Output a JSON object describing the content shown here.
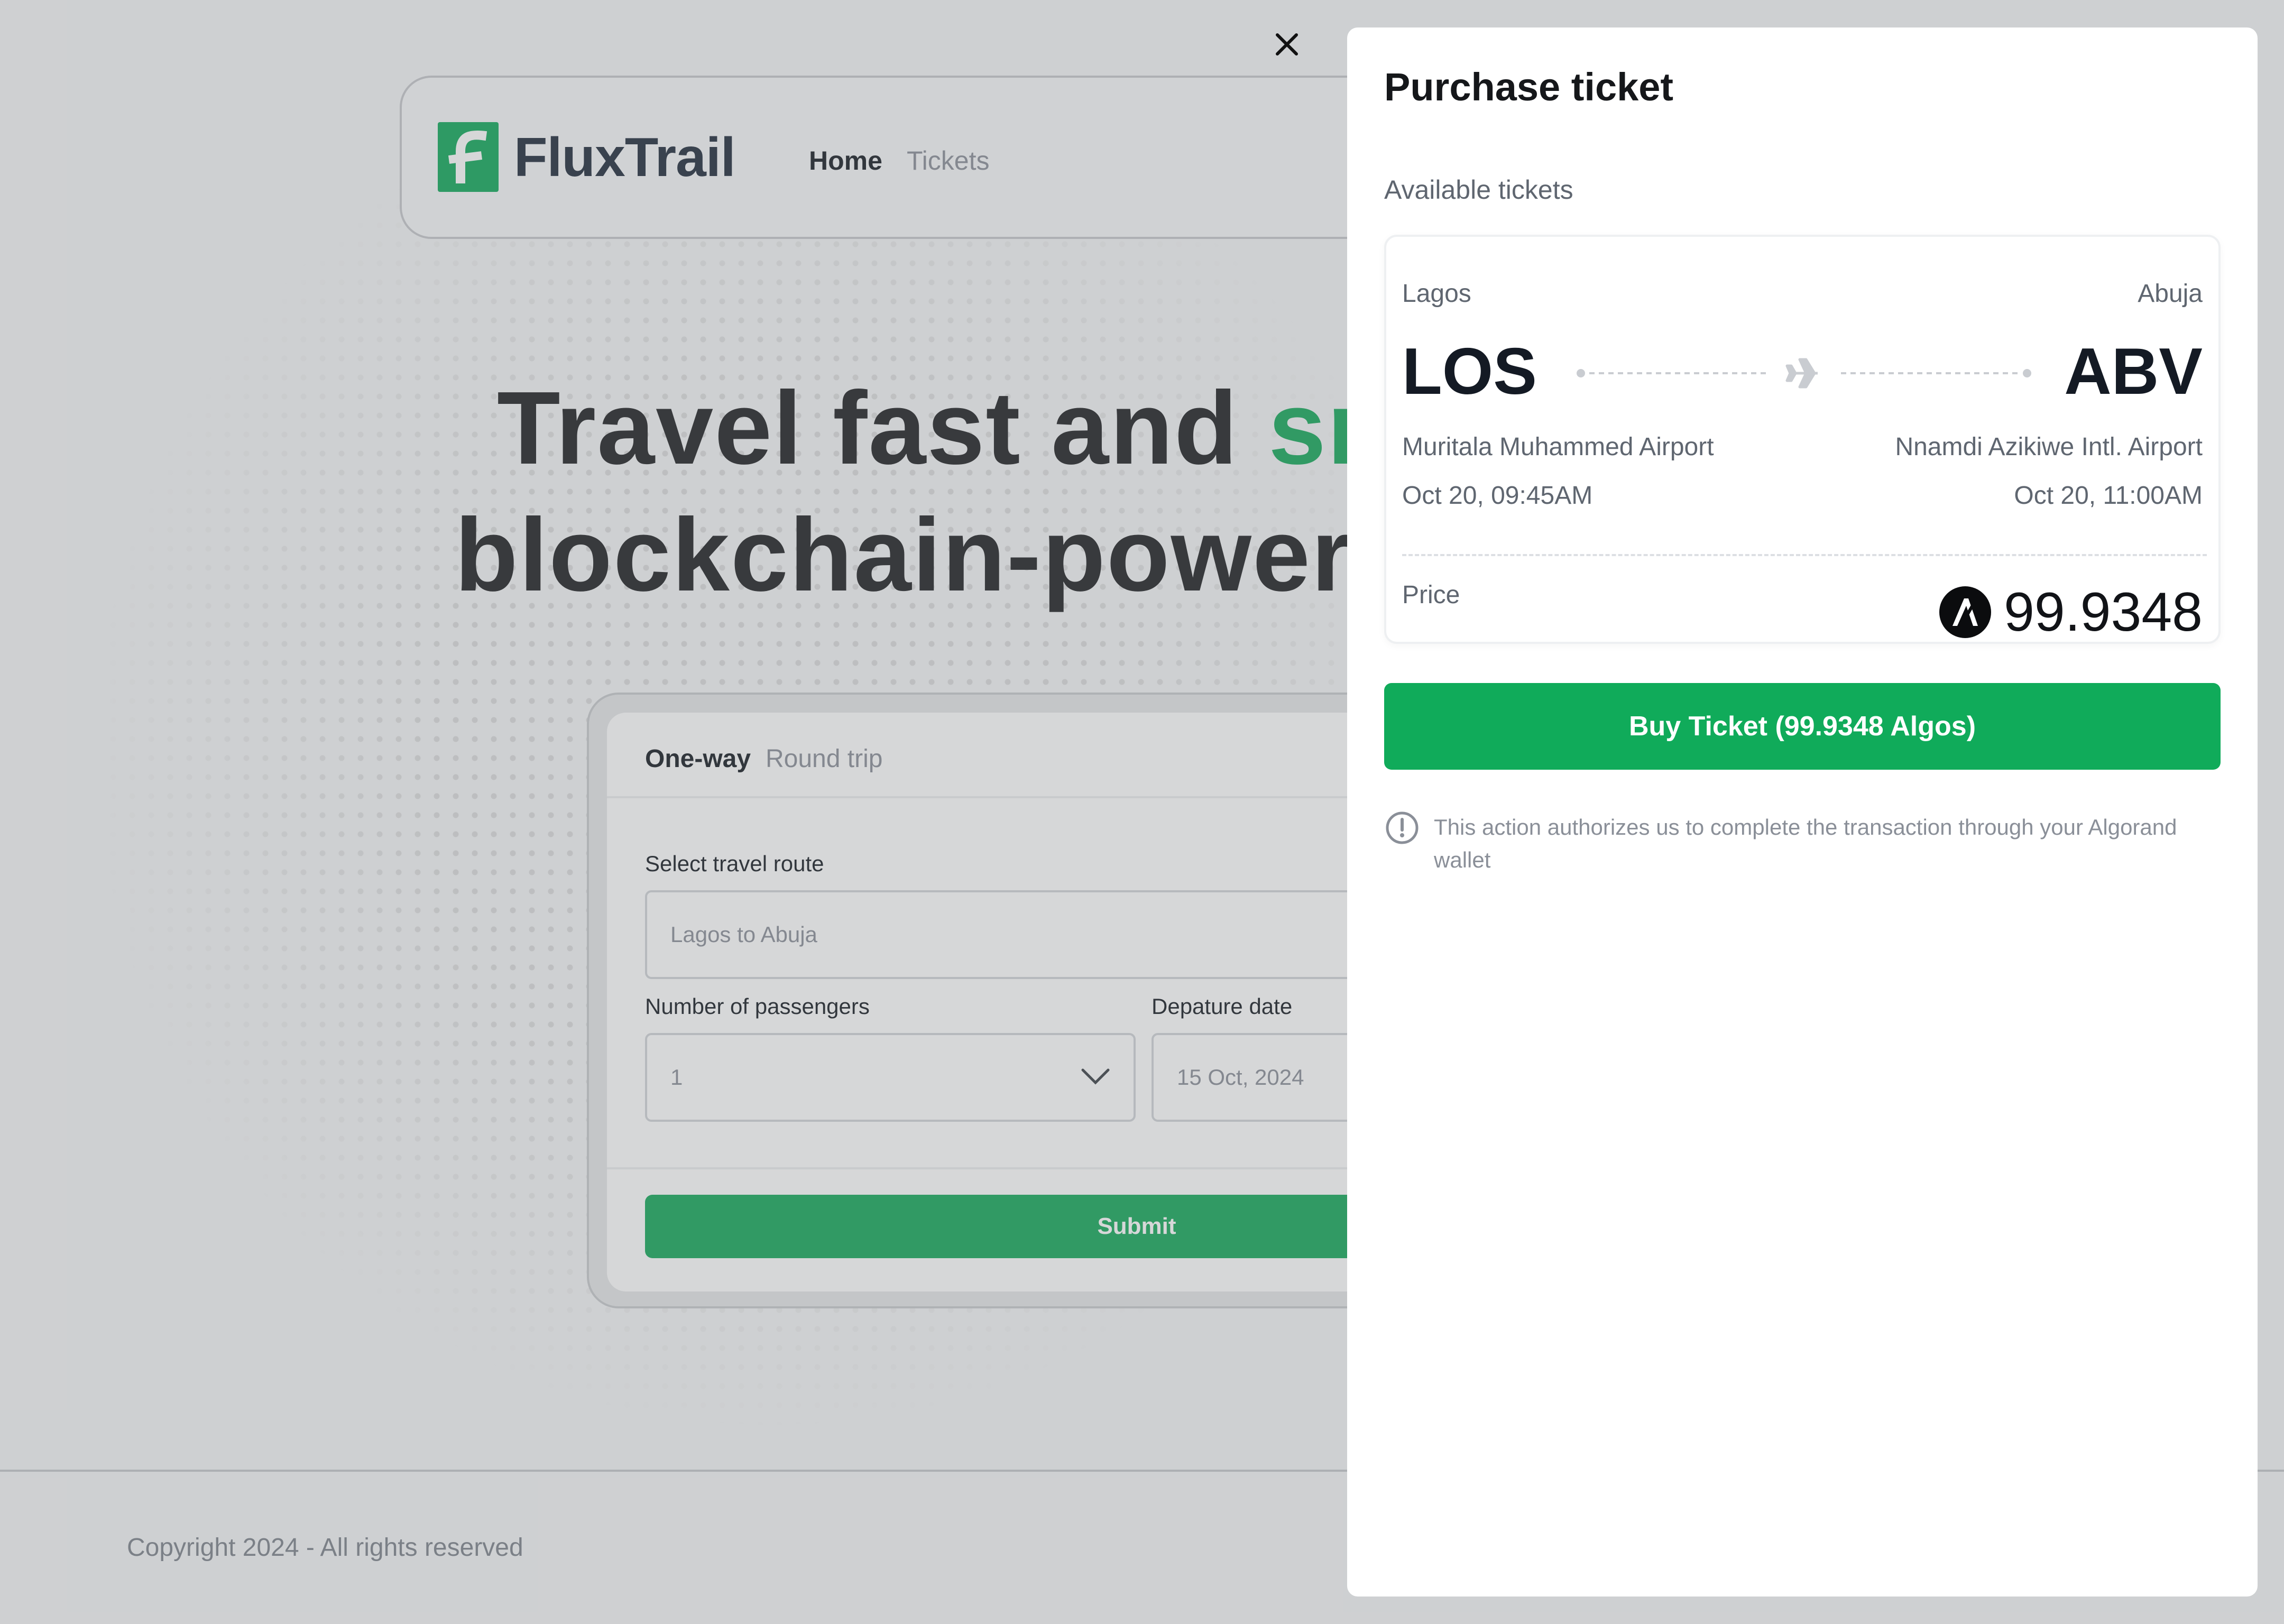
{
  "app": {
    "brand": "FluxTrail",
    "nav": {
      "home": "Home",
      "tickets": "Tickets"
    }
  },
  "hero": {
    "line1_plain": "Travel fast and ",
    "line1_green": "sr",
    "line2": "blockchain-power"
  },
  "form": {
    "tabs": {
      "one_way": "One-way",
      "round_trip": "Round trip"
    },
    "route_label": "Select travel route",
    "route_value": "Lagos to Abuja",
    "passengers_label": "Number of passengers",
    "passengers_value": "1",
    "date_label": "Depature date",
    "date_value": "15 Oct, 2024",
    "submit": "Submit"
  },
  "footer": {
    "copyright": "Copyright 2024 - All rights reserved"
  },
  "drawer": {
    "title": "Purchase ticket",
    "available_label": "Available tickets",
    "ticket": {
      "from_city": "Lagos",
      "to_city": "Abuja",
      "from_code": "LOS",
      "to_code": "ABV",
      "from_airport": "Muritala Muhammed Airport",
      "to_airport": "Nnamdi Azikiwe Intl. Airport",
      "from_time": "Oct 20, 09:45AM",
      "to_time": "Oct 20, 11:00AM",
      "price_label": "Price",
      "price_value": "99.9348"
    },
    "buy_button": "Buy Ticket (99.9348 Algos)",
    "notice": "This action authorizes us to complete the transaction through your Algorand wallet"
  },
  "colors": {
    "accent_green": "#10ab5a",
    "text_dark": "#15171a",
    "text_muted": "#5f6670"
  },
  "icons": {
    "close": "close-icon",
    "plane": "plane-icon",
    "algo": "algorand-coin-icon",
    "info": "info-circle-icon",
    "chevron": "chevron-down-icon"
  }
}
